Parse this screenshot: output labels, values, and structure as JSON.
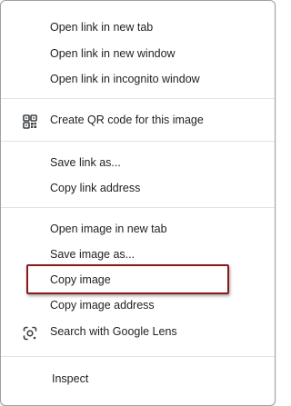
{
  "context_menu": {
    "items": [
      {
        "label": "Open link in new tab"
      },
      {
        "label": "Open link in new window"
      },
      {
        "label": "Open link in incognito window"
      },
      {
        "label": "Create QR code for this image",
        "icon": "qr-code-icon"
      },
      {
        "label": "Save link as..."
      },
      {
        "label": "Copy link address"
      },
      {
        "label": "Open image in new tab"
      },
      {
        "label": "Save image as..."
      },
      {
        "label": "Copy image",
        "highlighted": true
      },
      {
        "label": "Copy image address"
      },
      {
        "label": "Search with Google Lens",
        "icon": "google-lens-icon"
      },
      {
        "label": "Inspect"
      }
    ]
  },
  "colors": {
    "text": "#1f1f1f",
    "separator": "#e3e3e3",
    "highlight_border": "#8b1a1f",
    "icon": "#3c4043"
  }
}
